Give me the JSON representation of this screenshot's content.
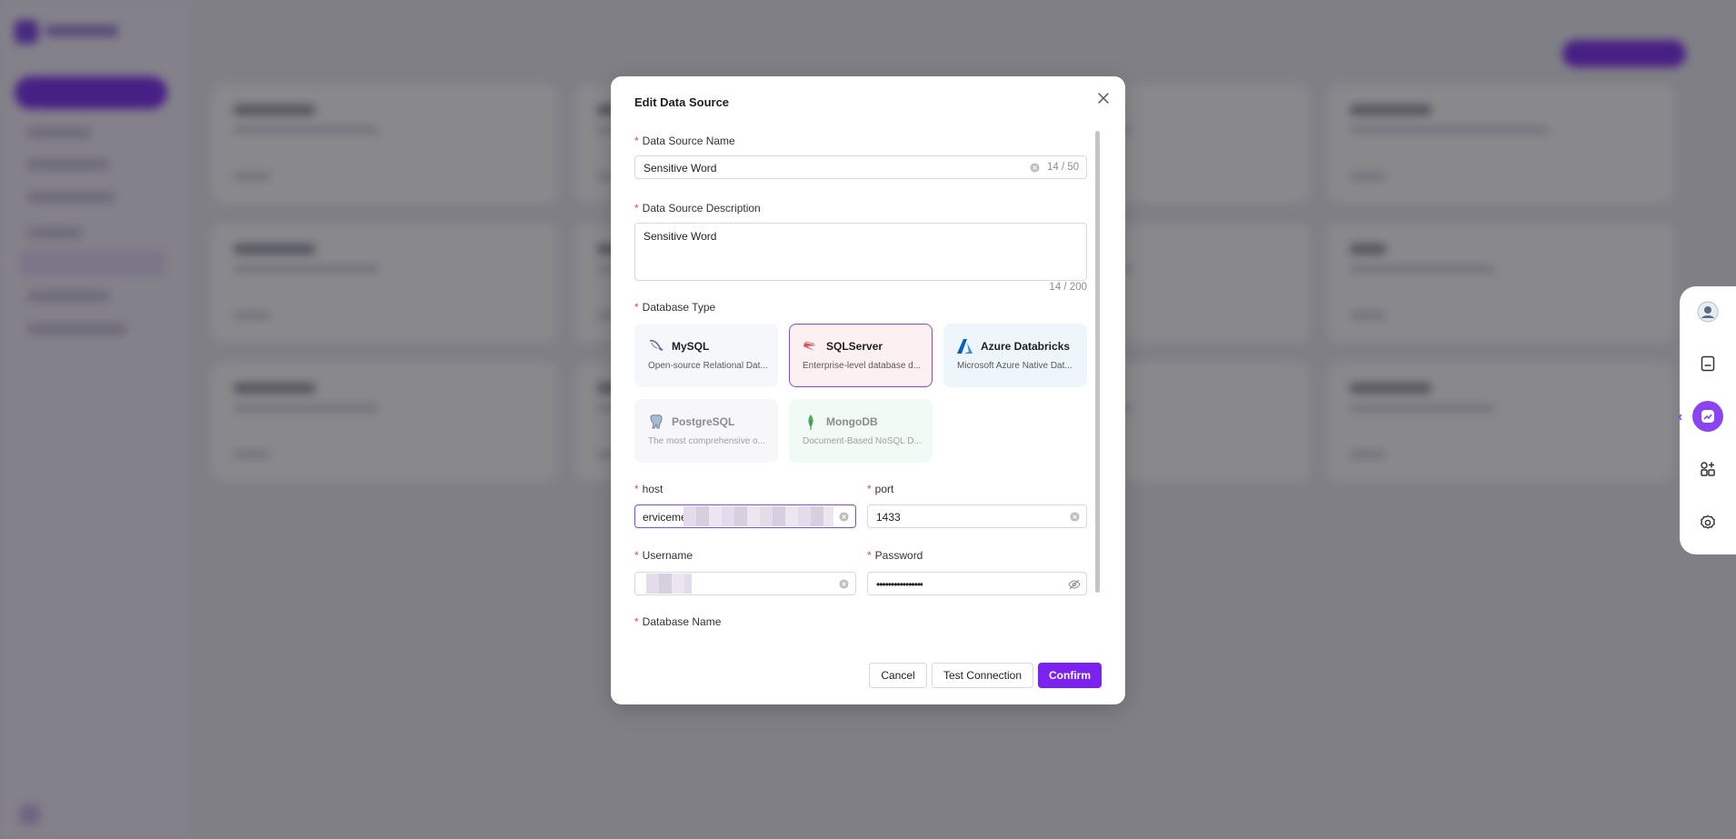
{
  "modal": {
    "title": "Edit Data Source",
    "fields": {
      "name": {
        "label": "Data Source Name",
        "value": "Sensitive Word",
        "counter": "14 / 50"
      },
      "description": {
        "label": "Data Source Description",
        "value": "Sensitive Word",
        "counter": "14 / 200"
      },
      "db_type": {
        "label": "Database Type"
      },
      "host": {
        "label": "host",
        "value": "erviceme"
      },
      "port": {
        "label": "port",
        "value": "1433"
      },
      "username": {
        "label": "Username",
        "value": ""
      },
      "password": {
        "label": "Password",
        "value": "••••••••••••••••"
      },
      "database_name": {
        "label": "Database Name"
      }
    },
    "db_types": [
      {
        "name": "MySQL",
        "desc": "Open-source Relational Dat...",
        "icon": "mysql-dolphin-icon",
        "state": "default"
      },
      {
        "name": "SQLServer",
        "desc": "Enterprise-level database d...",
        "icon": "sqlserver-icon",
        "state": "selected"
      },
      {
        "name": "Azure Databricks",
        "desc": "Microsoft Azure Native Dat...",
        "icon": "azure-icon",
        "state": "default"
      },
      {
        "name": "PostgreSQL",
        "desc": "The most comprehensive o...",
        "icon": "postgresql-elephant-icon",
        "state": "disabled"
      },
      {
        "name": "MongoDB",
        "desc": "Document-Based NoSQL D...",
        "icon": "mongodb-leaf-icon",
        "state": "disabled"
      }
    ],
    "buttons": {
      "cancel": "Cancel",
      "test": "Test Connection",
      "confirm": "Confirm"
    }
  },
  "right_toolbar": {
    "items": [
      "user-avatar-icon",
      "book-icon",
      "chart-assistant-icon",
      "apps-add-icon",
      "settings-icon"
    ]
  },
  "colors": {
    "accent": "#7b22f0",
    "required": "#e5484d",
    "selected_card_bg": "#fdf0f1",
    "selected_card_border": "#8a45f0"
  }
}
